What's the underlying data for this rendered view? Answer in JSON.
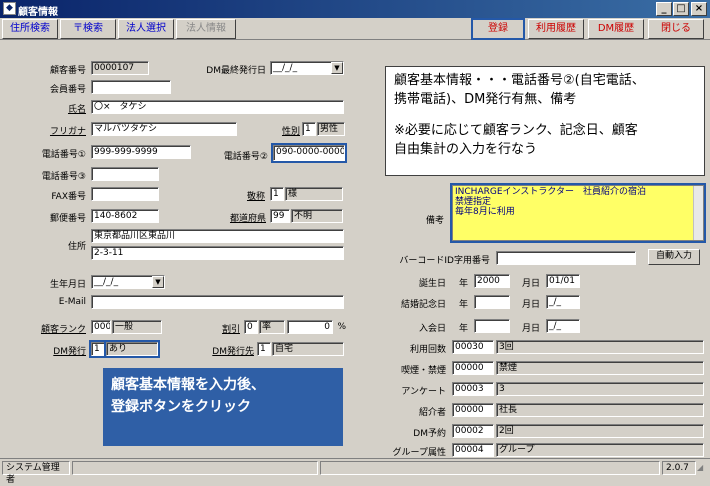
{
  "window": {
    "title": "顧客情報",
    "min": "_",
    "max": "□",
    "close": "×"
  },
  "toolbar": {
    "address_search": "住所検索",
    "postal_search": "〒検索",
    "corp_select": "法人選択",
    "corp_info": "法人情報",
    "register": "登録",
    "usage_history": "利用履歴",
    "dm_history": "DM履歴",
    "close": "閉じる"
  },
  "form": {
    "customer_no_label": "顧客番号",
    "customer_no": "0000107",
    "dm_last_date_label": "DM最終発行日",
    "dm_last_date": "__/_/_",
    "member_no_label": "会員番号",
    "member_no": "",
    "name_label": "氏名",
    "name": "〇×　タケシ",
    "kana_label": "フリガナ",
    "kana": "マルバツタケシ",
    "gender_label": "性別",
    "gender_code": "1",
    "gender": "男性",
    "phone1_label": "電話番号①",
    "phone1": "999-999-9999",
    "phone2_label": "電話番号②",
    "phone2": "090-0000-0000",
    "phone3_label": "電話番号③",
    "phone3": "",
    "fax_label": "FAX番号",
    "fax": "",
    "honorific_label": "敬称",
    "honorific_code": "1",
    "honorific": "様",
    "postal_label": "郵便番号",
    "postal": "140-8602",
    "pref_label": "都道府県",
    "pref_code": "99",
    "pref": "不明",
    "address_label": "住所",
    "address1": "東京都品川区東品川",
    "address2": "2-3-11",
    "remarks_label": "備考",
    "remarks": [
      "INCHARGEインストラクター　社員紹介の宿泊",
      "禁煙指定",
      "毎年8月に利用"
    ],
    "barcode_label": "バーコードID字用番号",
    "barcode": "",
    "auto_input": "自動入力",
    "birth_label": "生年月日",
    "birth": "__/_/_",
    "birthday_label": "誕生日",
    "birthday_year_label": "年",
    "birthday_year": "2000",
    "birthday_md_label": "月日",
    "birthday_md": "01/01",
    "email_label": "E-Mail",
    "email": "",
    "anniv_label": "結婚記念日",
    "anniv_year_label": "年",
    "anniv_year": "",
    "anniv_md_label": "月日",
    "anniv_md": "_/_",
    "rank_label": "顧客ランク",
    "rank_code": "000",
    "rank": "一般",
    "discount_label": "割引",
    "discount_code": "0",
    "discount_unit": "率",
    "discount_value": "0",
    "discount_pct": "%",
    "join_label": "入会日",
    "join_year_label": "年",
    "join_year": "",
    "join_md_label": "月日",
    "join_md": "_/_",
    "usage_label": "利用回数",
    "usage_code": "00030",
    "usage": "3回",
    "dm_issue_label": "DM発行",
    "dm_issue_code": "1",
    "dm_issue": "あり",
    "dm_dest_label": "DM発行先",
    "dm_dest_code": "1",
    "dm_dest": "自宅",
    "smoking_label": "喫煙・禁煙",
    "smoking_code": "00000",
    "smoking": "禁煙",
    "survey_label": "アンケート",
    "survey_code": "00003",
    "survey": "3",
    "referrer_label": "紹介者",
    "referrer_code": "00000",
    "referrer": "社長",
    "dm_reserve_label": "DM予約",
    "dm_reserve_code": "00002",
    "dm_reserve": "2回",
    "group_label": "グループ属性",
    "group_code": "00004",
    "group": "グループ"
  },
  "callout_top": {
    "line1": "顧客基本情報・・・電話番号②(自宅電話、",
    "line2": "携帯電話)、DM発行有無、備考",
    "line3": "※必要に応じて顧客ランク、記念日、顧客",
    "line4": "自由集計の入力を行なう"
  },
  "callout_bottom": {
    "line1": "顧客基本情報を入力後、",
    "line2": "登録ボタンをクリック"
  },
  "statusbar": {
    "user": "システム管理者",
    "version": "2.0.7"
  }
}
